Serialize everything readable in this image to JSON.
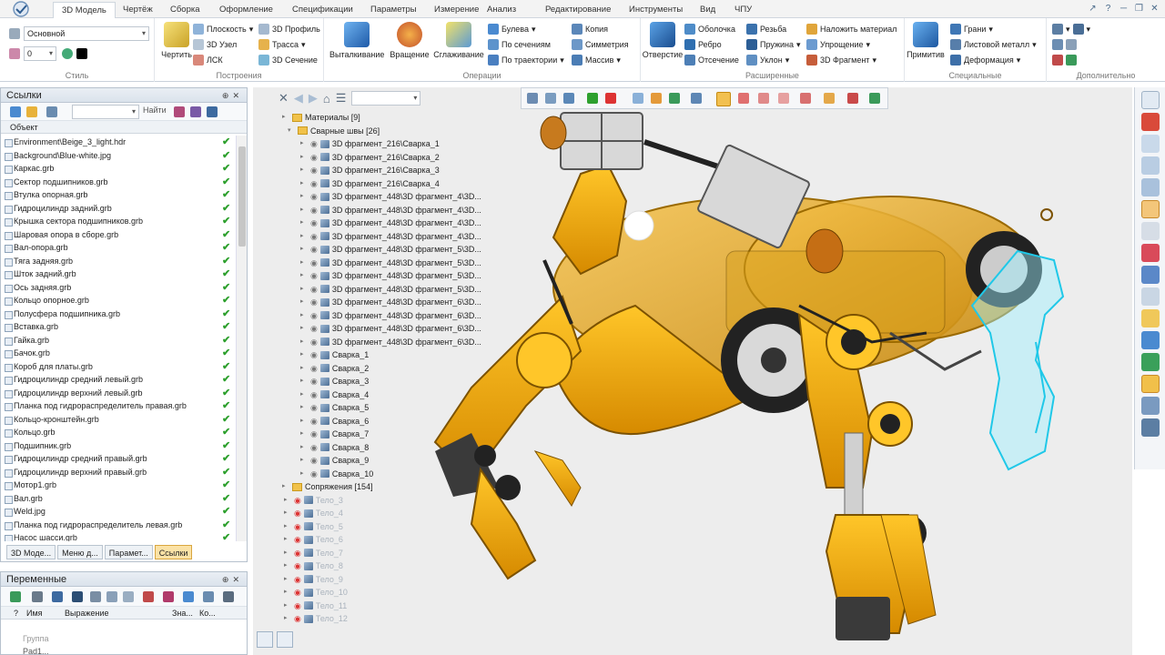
{
  "tabs": [
    "3D Модель",
    "Чертёж",
    "Сборка",
    "Оформление",
    "Спецификации",
    "Параметры",
    "Измерение",
    "Анализ",
    "Редактирование",
    "Инструменты",
    "Вид",
    "ЧПУ"
  ],
  "active_tab": "3D Модель",
  "ribbon": {
    "style": {
      "layer": "Основной",
      "number": "0",
      "caption": "Стиль"
    },
    "build": {
      "sketch": "Чертить",
      "plane": "Плоскость",
      "node3d": "3D Узел",
      "lcs": "ЛСК",
      "profile3d": "3D Профиль",
      "path": "Трасса",
      "section3d": "3D Сечение",
      "caption": "Построения"
    },
    "ops": {
      "extrude": "Выталкивание",
      "revolve": "Вращение",
      "smooth": "Сглаживание",
      "boolean": "Булева",
      "by_sections": "По сечениям",
      "by_path": "По траектории",
      "copy": "Копия",
      "symmetry": "Симметрия",
      "array": "Массив",
      "caption": "Операции"
    },
    "ext": {
      "hole": "Отверстие",
      "shell": "Оболочка",
      "rib": "Ребро",
      "cut": "Отсечение",
      "thread": "Резьба",
      "spring": "Пружина",
      "draft": "Уклон",
      "apply_material": "Наложить материал",
      "simplify": "Упрощение",
      "fragment3d": "3D Фрагмент",
      "caption": "Расширенные"
    },
    "special": {
      "primitive": "Примитив",
      "faces": "Грани",
      "sheet_metal": "Листовой металл",
      "deform": "Деформация",
      "caption": "Специальные"
    },
    "extra": {
      "caption": "Дополнительно"
    }
  },
  "links_panel": {
    "title": "Ссылки",
    "find_label": "Найти",
    "column": "Объект",
    "items": [
      "Environment\\Beige_3_light.hdr",
      "Background\\Blue-white.jpg",
      "Каркас.grb",
      "Сектор подшипников.grb",
      "Втулка опорная.grb",
      "Гидроцилиндр задний.grb",
      "Крышка сектора подшипников.grb",
      "Шаровая опора в сборе.grb",
      "Вал-опора.grb",
      "Тяга задняя.grb",
      "Шток задний.grb",
      "Ось задняя.grb",
      "Кольцо опорное.grb",
      "Полусфера подшипника.grb",
      "Вставка.grb",
      "Гайка.grb",
      "Бачок.grb",
      "Короб для платы.grb",
      "Гидроцилиндр средний левый.grb",
      "Гидроцилиндр верхний левый.grb",
      "Планка под гидрораспределитель правая.grb",
      "Кольцо-кронштейн.grb",
      "Кольцо.grb",
      "Подшипник.grb",
      "Гидроцилиндр средний правый.grb",
      "Гидроцилиндр верхний правый.grb",
      "Мотор1.grb",
      "Вал.grb",
      "Weld.jpg",
      "Планка под гидрораспределитель левая.grb",
      "Насос шасси.grb"
    ],
    "bottom_tabs": [
      "3D Моде...",
      "Меню д...",
      "Парамет...",
      "Ссылки"
    ]
  },
  "vars_panel": {
    "title": "Переменные",
    "columns": [
      "?",
      "Имя",
      "Выражение",
      "Зна...",
      "Ко..."
    ],
    "group_row": "Группа",
    "cut_row": "Pad1..."
  },
  "tree": {
    "materials": "Материалы [9]",
    "welds": "Сварные швы [26]",
    "welds_children": [
      "3D фрагмент_216\\Сварка_1",
      "3D фрагмент_216\\Сварка_2",
      "3D фрагмент_216\\Сварка_3",
      "3D фрагмент_216\\Сварка_4",
      "3D фрагмент_448\\3D фрагмент_4\\3D...",
      "3D фрагмент_448\\3D фрагмент_4\\3D...",
      "3D фрагмент_448\\3D фрагмент_4\\3D...",
      "3D фрагмент_448\\3D фрагмент_4\\3D...",
      "3D фрагмент_448\\3D фрагмент_5\\3D...",
      "3D фрагмент_448\\3D фрагмент_5\\3D...",
      "3D фрагмент_448\\3D фрагмент_5\\3D...",
      "3D фрагмент_448\\3D фрагмент_5\\3D...",
      "3D фрагмент_448\\3D фрагмент_6\\3D...",
      "3D фрагмент_448\\3D фрагмент_6\\3D...",
      "3D фрагмент_448\\3D фрагмент_6\\3D...",
      "3D фрагмент_448\\3D фрагмент_6\\3D...",
      "Сварка_1",
      "Сварка_2",
      "Сварка_3",
      "Сварка_4",
      "Сварка_5",
      "Сварка_6",
      "Сварка_7",
      "Сварка_8",
      "Сварка_9",
      "Сварка_10"
    ],
    "mates": "Сопряжения [154]",
    "bodies": [
      "Тело_3",
      "Тело_4",
      "Тело_5",
      "Тело_6",
      "Тело_7",
      "Тело_8",
      "Тело_9",
      "Тело_10",
      "Тело_11",
      "Тело_12"
    ]
  },
  "colors": {
    "accent": "#1f5fa8",
    "robot": "#f2a300",
    "robot_dark": "#b77800",
    "glass": "#46d7f0",
    "check": "#2ea02e",
    "active_tab_bg": "#fbe2a6"
  }
}
